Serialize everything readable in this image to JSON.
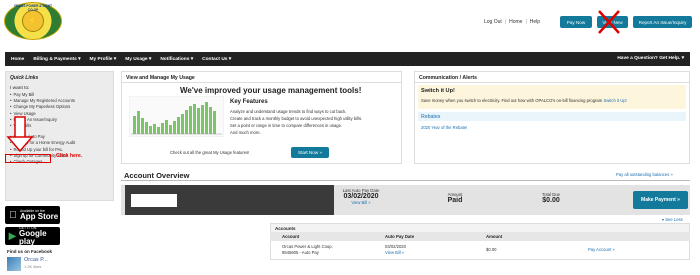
{
  "header": {
    "logo_text": "ORCAS POWER & LIGHT CO-OP",
    "logout": "Log Out",
    "home": "Home",
    "help": "Help",
    "pay_now": "Pay Now",
    "view_new": "View New",
    "report_outage": "Report An Issue/Inquiry"
  },
  "nav": {
    "items": [
      "Home",
      "Billing & Payments ▾",
      "My Profile ▾",
      "My Usage ▾",
      "Notifications ▾",
      "Contact Us ▾"
    ],
    "right": "Have a Question? Get Help. ▾"
  },
  "quick_links": {
    "title": "Quick Links",
    "want": "I want to:",
    "items": [
      "Pay My Bill",
      "Manage My Registered Accounts",
      "Change My Paperless Options",
      "View Usage",
      "Report An Issue/Inquiry",
      "View Bills",
      "Update Auto Pay",
      "Sign Up for a Home Energy Audit",
      "Round Up your bill for PAL",
      "Sign up for Community Solar!",
      "Check Outages"
    ],
    "click_here": "Click here."
  },
  "badges": {
    "appstore_small": "Available on the",
    "appstore_big": "App Store",
    "gplay_small": "GET IT ON",
    "gplay_big": "Google play"
  },
  "facebook": {
    "title": "Find us on Facebook",
    "name": "Orcas P...",
    "likes": "1.2K likes"
  },
  "usage": {
    "header": "View and Manage My Usage",
    "title": "We've improved your usage management tools!",
    "kf_title": "Key Features",
    "kf_lines": [
      "Analyze and understand usage trends to find ways to cut back.",
      "Create and track a monthly budget to avoid unexpected high utility bills.",
      "Set a point or range in time to compare differences in usage.",
      "And much more."
    ],
    "checkout": "Check out all the great My Usage features!",
    "start_now": "Start Now »"
  },
  "alerts": {
    "header": "Communication / Alerts",
    "switch_title": "Switch it Up!",
    "switch_text": "Save money when you switch to electricity. Find out how with OPALCO's on-bill financing program",
    "switch_link": "Switch it Up!",
    "rebates": "Rebates",
    "rebate_link": "2020 Year of the Rebate!"
  },
  "overview": {
    "title": "Account Overview",
    "pay_all": "Pay all outstanding balances »",
    "last_auto_lbl": "Last Auto Pay Date",
    "last_auto_val": "03/02/2020",
    "view_bill": "View Bill »",
    "amount_lbl": "Amount",
    "amount_val": "Paid",
    "total_lbl": "Total Due",
    "total_val": "$0.00",
    "make_payment": "Make Payment »",
    "see_less": "▾ See Less"
  },
  "accounts": {
    "header": "Accounts",
    "col_account": "Account",
    "col_auto": "Auto Pay Date",
    "col_amount": "Amount",
    "row_name": "Orcas Power & Light Coop.",
    "row_sub": "9545605 - Auto Pay",
    "row_date": "03/02/2020",
    "row_view": "View Bill »",
    "row_amount": "$0.00",
    "row_link": "Pay Account »"
  },
  "colors": {
    "accent": "#137a9b",
    "nav": "#222222",
    "annotation": "#dd0000"
  }
}
